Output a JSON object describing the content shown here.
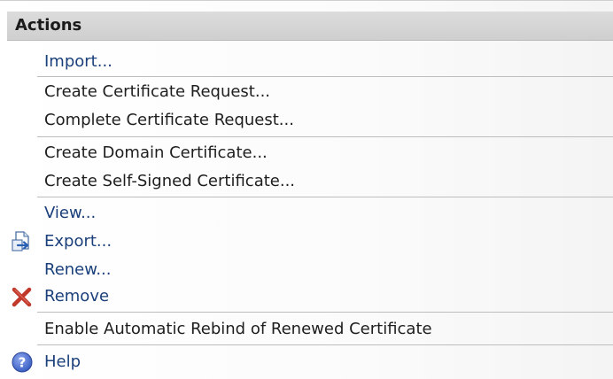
{
  "header": {
    "title": "Actions"
  },
  "items": [
    {
      "label": "Import..."
    },
    {
      "label": "Create Certificate Request..."
    },
    {
      "label": "Complete Certificate Request..."
    },
    {
      "label": "Create Domain Certificate..."
    },
    {
      "label": "Create Self-Signed Certificate..."
    },
    {
      "label": "View..."
    },
    {
      "label": "Export...",
      "icon": "export-icon"
    },
    {
      "label": "Renew..."
    },
    {
      "label": "Remove",
      "icon": "remove-x-icon"
    },
    {
      "label": "Enable Automatic Rebind of Renewed Certificate"
    },
    {
      "label": "Help",
      "icon": "help-icon"
    }
  ],
  "colors": {
    "link_text": "#1a3f7a",
    "dark_text": "#1e1e1e",
    "remove_icon": "#c0392b",
    "help_icon": "#3b5fc4"
  }
}
